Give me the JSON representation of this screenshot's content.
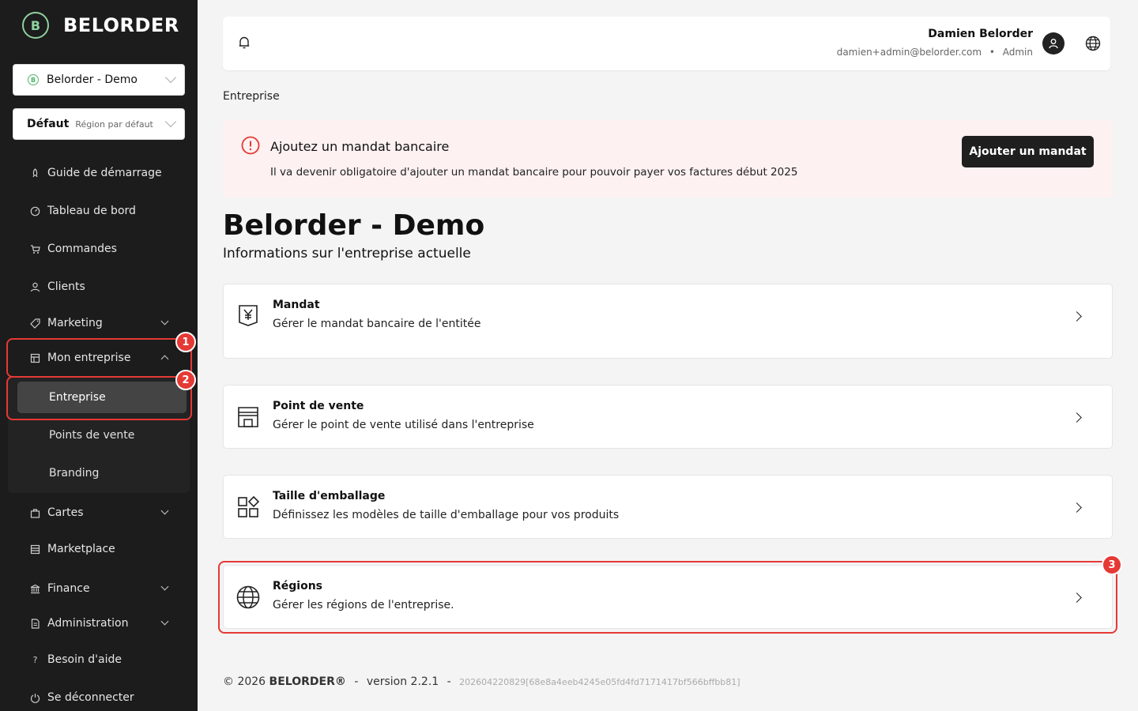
{
  "brand": {
    "name": "BELORDER"
  },
  "sidebar": {
    "company_select": "Belorder - Demo",
    "region_select": {
      "main": "Défaut",
      "sub": "Région par défaut"
    },
    "items": [
      {
        "label": "Guide de démarrage",
        "icon": "rocket-icon"
      },
      {
        "label": "Tableau de bord",
        "icon": "dashboard-icon"
      },
      {
        "label": "Commandes",
        "icon": "cart-icon"
      },
      {
        "label": "Clients",
        "icon": "user-icon"
      },
      {
        "label": "Marketing",
        "icon": "tag-icon"
      },
      {
        "label": "Mon entreprise",
        "icon": "store-icon"
      },
      {
        "label": "Cartes",
        "icon": "bag-icon"
      },
      {
        "label": "Marketplace",
        "icon": "marketplace-icon"
      },
      {
        "label": "Finance",
        "icon": "bank-icon"
      },
      {
        "label": "Administration",
        "icon": "document-icon"
      },
      {
        "label": "Besoin d'aide",
        "icon": "help-icon"
      },
      {
        "label": "Se déconnecter",
        "icon": "logout-icon"
      }
    ],
    "submenu": [
      {
        "label": "Entreprise"
      },
      {
        "label": "Points de vente"
      },
      {
        "label": "Branding"
      }
    ]
  },
  "annotations": [
    "1",
    "2",
    "3"
  ],
  "header": {
    "user_name": "Damien Belorder",
    "user_email": "damien+admin@belorder.com",
    "separator": "•",
    "user_role": "Admin"
  },
  "breadcrumb": "Entreprise",
  "alert": {
    "title": "Ajoutez un mandat bancaire",
    "text": "Il va devenir obligatoire d'ajouter un mandat bancaire pour pouvoir payer vos factures début 2025",
    "button": "Ajouter un mandat",
    "color": "#fdf1f1"
  },
  "page": {
    "title": "Belorder - Demo",
    "subtitle": "Informations sur l'entreprise actuelle"
  },
  "cards": [
    {
      "title": "Mandat",
      "desc": "Gérer le mandat bancaire de l'entitée",
      "icon": "yen-document-icon"
    },
    {
      "title": "Point de vente",
      "desc": "Gérer le point de vente utilisé dans l'entreprise",
      "icon": "storefront-icon"
    },
    {
      "title": "Taille d'emballage",
      "desc": "Définissez les modèles de taille d'emballage pour vos produits",
      "icon": "shapes-icon"
    },
    {
      "title": "Régions",
      "desc": "Gérer les régions de l'entreprise.",
      "icon": "globe-icon"
    }
  ],
  "footer": {
    "copyright": "© 2026",
    "brand": "BELORDER®",
    "dash": "-",
    "version": "version 2.2.1",
    "hash": "202604220829[68e8a4eeb4245e05fd4fd7171417bf566bffbb81]"
  },
  "colors": {
    "sidebar": "#1c1c1c",
    "accent_red": "#e53935",
    "logo_green": "#8fd19e"
  }
}
